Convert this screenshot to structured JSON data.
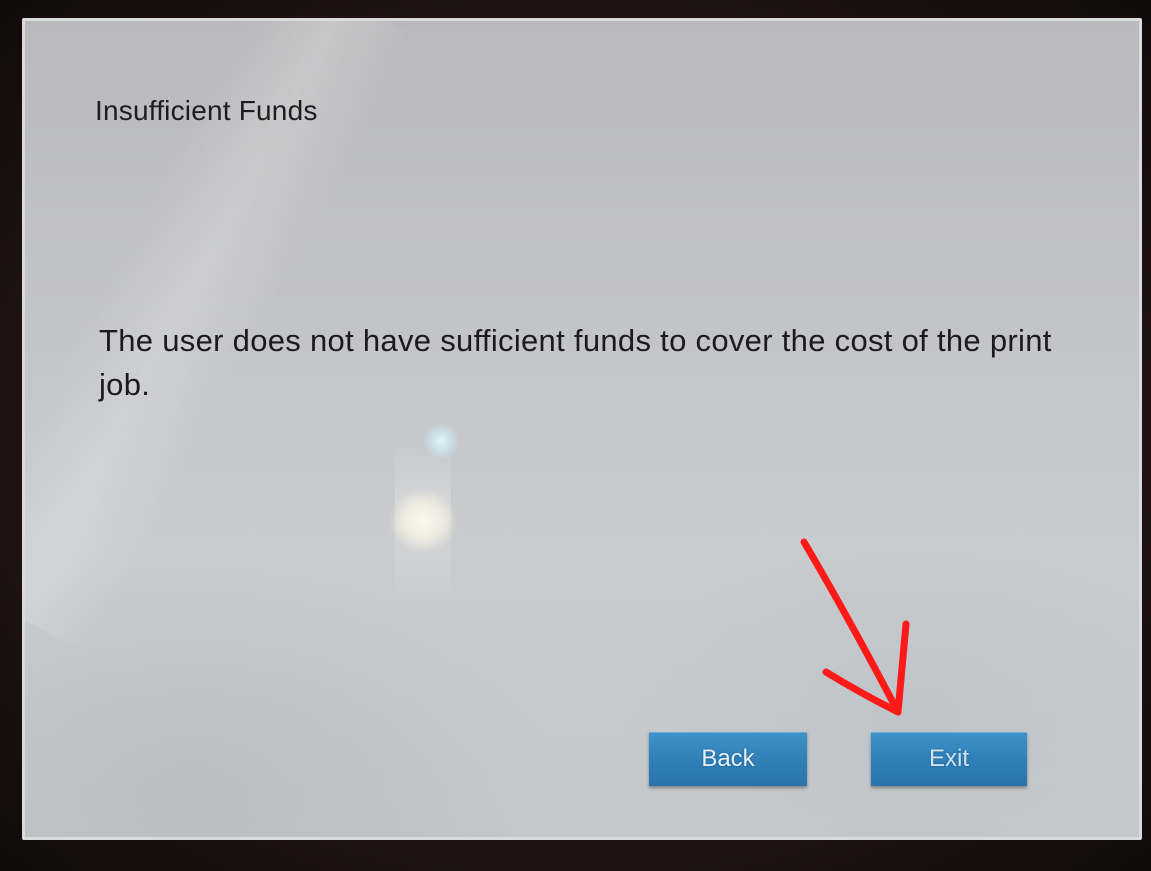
{
  "dialog": {
    "title": "Insufficient Funds",
    "message": "The user does not have sufficient funds to cover the cost of the print job."
  },
  "buttons": {
    "back_label": "Back",
    "exit_label": "Exit"
  },
  "colors": {
    "button_blue": "#2f7fb7",
    "screen_gray": "#c4c6c8",
    "annotation_red": "#ff1a1a"
  },
  "annotation": {
    "icon": "red-arrow-icon"
  }
}
